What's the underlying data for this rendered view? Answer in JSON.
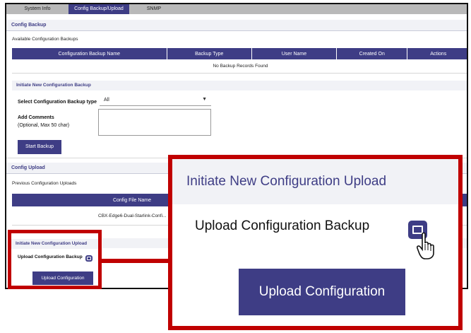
{
  "tabs": [
    {
      "label": "System Info"
    },
    {
      "label": "Config Backup/Upload"
    },
    {
      "label": "SNMP"
    }
  ],
  "config_backup": {
    "title": "Config Backup",
    "available_label": "Available Configuration Backups",
    "columns": [
      "Configuration Backup Name",
      "Backup Type",
      "User Name",
      "Created On",
      "Actions"
    ],
    "empty_message": "No Backup Records Found",
    "initiate_title": "Initiate New Configuration Backup",
    "type_label": "Select Configuration Backup type",
    "type_value": "All",
    "comments_label_1": "Add Comments",
    "comments_label_2": "(Optional, Max 50 char)",
    "start_button": "Start Backup"
  },
  "config_upload": {
    "title": "Config Upload",
    "previous_label": "Previous Configuration Uploads",
    "columns": [
      "Config File Name"
    ],
    "rows": [
      [
        "CBX-Edge6-Dual-Starlink-Confi..."
      ]
    ],
    "initiate_title": "Initiate New Configuration Upload",
    "upload_label": "Upload Configuration Backup",
    "upload_button": "Upload Configuration"
  },
  "colors": {
    "accent": "#3e3d85",
    "callout": "#c00000"
  },
  "icons": {
    "file_upload": "folder-icon",
    "cursor": "hand-pointer-icon"
  }
}
